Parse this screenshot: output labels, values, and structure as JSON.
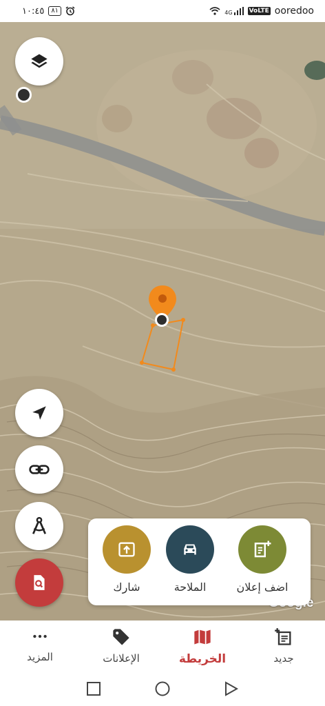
{
  "status_bar": {
    "time": "١٠:٤٥",
    "battery": "٨١",
    "network": "4G",
    "volte": "VoLTE",
    "carrier": "ooredoo"
  },
  "map": {
    "provider_logo": "Google",
    "view": "satellite",
    "controls": {
      "layers_icon": "layers-icon",
      "locate_icon": "navigation-arrow-icon",
      "link_icon": "link-icon",
      "measure_icon": "compass-icon",
      "search_icon": "document-search-icon"
    },
    "accent": "#c33c3c",
    "pin_color": "#f28a1c"
  },
  "action_card": {
    "actions": [
      {
        "label": "شارك",
        "icon": "share-upload-icon",
        "color": "#b9912f"
      },
      {
        "label": "الملاحة",
        "icon": "car-icon",
        "color": "#2b4a59"
      },
      {
        "label": "اضف إعلان",
        "icon": "add-note-icon",
        "color": "#7d8a35"
      }
    ]
  },
  "bottom_nav": {
    "items": [
      {
        "label": "المزيد",
        "icon": "more-dots-icon",
        "active": false
      },
      {
        "label": "الإعلانات",
        "icon": "tag-icon",
        "active": false
      },
      {
        "label": "الخريطة",
        "icon": "map-icon",
        "active": true
      },
      {
        "label": "جديد",
        "icon": "new-list-icon",
        "active": false
      }
    ]
  }
}
